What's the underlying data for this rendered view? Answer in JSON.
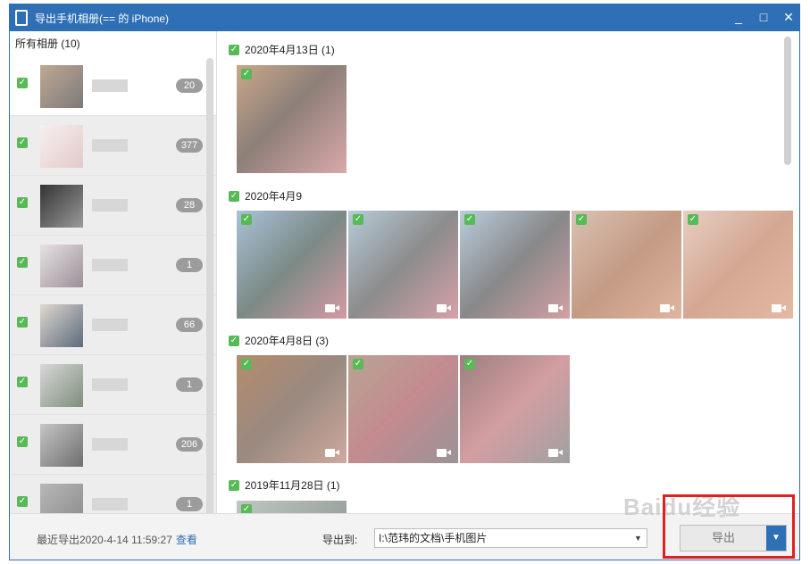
{
  "window": {
    "title": "导出手机相册(== 的 iPhone)",
    "accent": "#2f6fb6",
    "controls": {
      "minimize": "_",
      "maximize": "□",
      "close": "✕"
    }
  },
  "sidebar": {
    "header": "所有相册 (10)",
    "albums": [
      {
        "count": "20",
        "checked": true
      },
      {
        "count": "377",
        "checked": true
      },
      {
        "count": "28",
        "checked": true
      },
      {
        "count": "1",
        "checked": true
      },
      {
        "count": "66",
        "checked": true
      },
      {
        "count": "1",
        "checked": true
      },
      {
        "count": "206",
        "checked": true
      },
      {
        "count": "1",
        "checked": true
      }
    ]
  },
  "main": {
    "groups": [
      {
        "date": "2020年4月13日 (1)"
      },
      {
        "date": "2020年4月9"
      },
      {
        "date": "2020年4月8日 (3)"
      },
      {
        "date": "2019年11月28日 (1)"
      }
    ]
  },
  "footer": {
    "last_export": "最近导出2020-4-14 11:59:27",
    "view_link": "查看",
    "export_to_label": "导出到:",
    "export_path": "I:\\范玮的文档\\手机图片",
    "export_button": "导出"
  },
  "watermark": "Baidu经验"
}
